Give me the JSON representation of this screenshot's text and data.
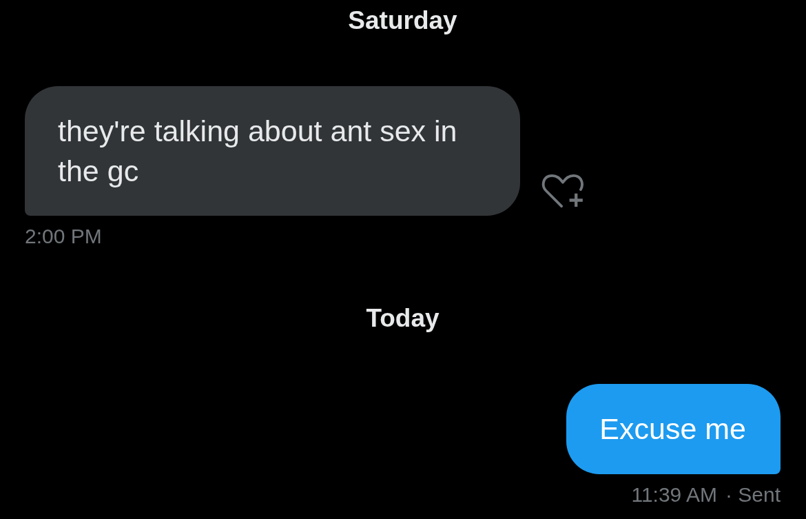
{
  "conversation": [
    {
      "kind": "date",
      "label": "Saturday"
    },
    {
      "kind": "received",
      "text": "they're talking about ant sex in the gc",
      "time": "2:00 PM",
      "react_button": true
    },
    {
      "kind": "date",
      "label": "Today"
    },
    {
      "kind": "sent",
      "text": "Excuse me",
      "time": "11:39 AM",
      "status": "· Sent"
    }
  ]
}
